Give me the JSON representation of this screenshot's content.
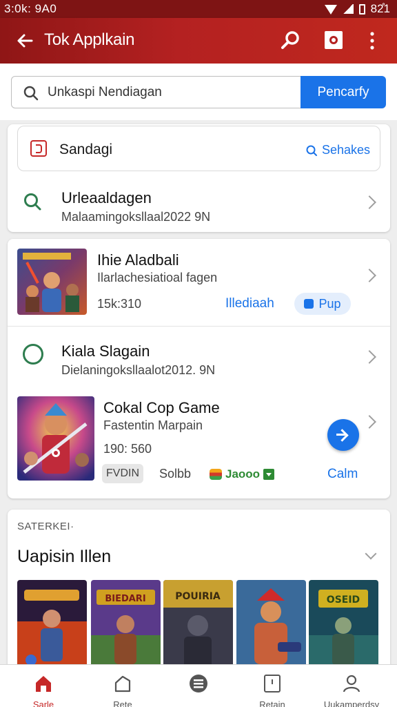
{
  "status_bar": {
    "time": "3:0k: 9A0",
    "battery": "82̊1"
  },
  "app_bar": {
    "title": "Tok Applkain"
  },
  "search": {
    "placeholder": "Unkaspi Nendiagan",
    "button_label": "Pencarfy"
  },
  "top_card": {
    "category": {
      "label": "Sandagi",
      "link_label": "Sehakes"
    },
    "row": {
      "title": "Urleaaldagen",
      "subtitle": "Malaamingoksllaal2022 9N"
    }
  },
  "app_list": [
    {
      "title": "Ihie Aladbali",
      "subtitle": "Ilarlachesiatioal fagen",
      "stat": "15k:310",
      "link": "Illediaah",
      "pill": "Pup"
    },
    {
      "title": "Kiala Slagain",
      "subtitle": "Dielaningoksllaalot2012. 9N"
    },
    {
      "title": "Cokal Cop Game",
      "subtitle": "Fastentin Marpain",
      "stat": "190: 560",
      "chip": "FVDIN",
      "size": "Solbb",
      "badge": "Jaooo",
      "action": "Calm"
    }
  ],
  "section": {
    "caps_label": "SATERKEI·",
    "title": "Uapisin Illen"
  },
  "gallery": [
    {
      "caption": "",
      "theme": "red"
    },
    {
      "caption": "BIEDARI",
      "theme": "purple"
    },
    {
      "caption": "POUIRIA",
      "theme": "gold"
    },
    {
      "caption": "",
      "theme": "orange"
    },
    {
      "caption": "OSEID",
      "theme": "teal"
    }
  ],
  "bottom_nav": [
    {
      "label": "Sarle",
      "icon": "home-icon",
      "active": true
    },
    {
      "label": "Rete",
      "icon": "tag-icon",
      "active": false
    },
    {
      "label": "",
      "icon": "menu-circle-icon",
      "active": false
    },
    {
      "label": "Retain",
      "icon": "bookmark-icon",
      "active": false
    },
    {
      "label": "Uukamperdsy",
      "icon": "person-icon",
      "active": false
    }
  ],
  "colors": {
    "primary": "#b42121",
    "accent": "#1a73e8",
    "green": "#2e7d4f"
  }
}
